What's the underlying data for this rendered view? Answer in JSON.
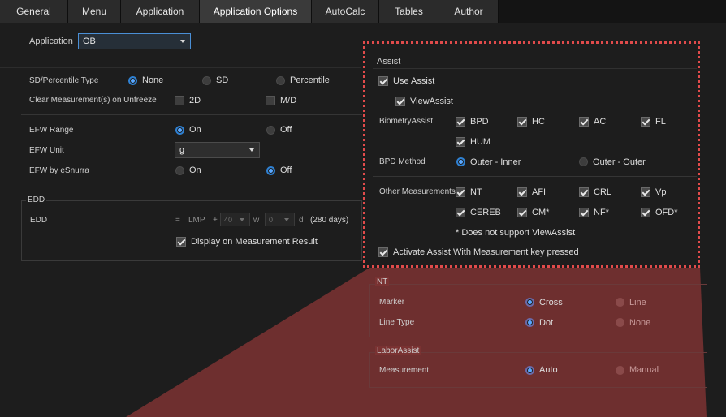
{
  "tabs": [
    "General",
    "Menu",
    "Application",
    "Application Options",
    "AutoCalc",
    "Tables",
    "Author"
  ],
  "active_tab": "Application Options",
  "application": {
    "label": "Application",
    "value": "OB"
  },
  "sd_percentile": {
    "label": "SD/Percentile Type",
    "options": [
      "None",
      "SD",
      "Percentile"
    ],
    "selected": "None"
  },
  "clear_meas": {
    "label": "Clear Measurement(s) on Unfreeze",
    "options": [
      "2D",
      "M/D"
    ],
    "checked": [
      false,
      false
    ]
  },
  "efw_range": {
    "label": "EFW Range",
    "options": [
      "On",
      "Off"
    ],
    "selected": "On"
  },
  "efw_unit": {
    "label": "EFW Unit",
    "value": "g"
  },
  "efw_esnurra": {
    "label": "EFW by eSnurra",
    "options": [
      "On",
      "Off"
    ],
    "selected": "Off"
  },
  "edd": {
    "title": "EDD",
    "label": "EDD",
    "eq": "=",
    "lmp": "LMP",
    "plus": "+",
    "weeks_value": "40",
    "w": "w",
    "days_value": "0",
    "d": "d",
    "total": "(280 days)",
    "display_label": "Display on Measurement Result",
    "display_checked": true
  },
  "assist": {
    "title": "Assist",
    "use_assist": "Use Assist",
    "view_assist": "ViewAssist",
    "biometry_label": "BiometryAssist",
    "biometry_items": [
      "BPD",
      "HC",
      "AC",
      "FL",
      "HUM"
    ],
    "bpd_method_label": "BPD Method",
    "bpd_method_options": [
      "Outer - Inner",
      "Outer - Outer"
    ],
    "bpd_method_selected": "Outer - Inner",
    "other_label": "Other Measurements",
    "other_items": [
      "NT",
      "AFI",
      "CRL",
      "Vp",
      "CEREB",
      "CM*",
      "NF*",
      "OFD*"
    ],
    "note": "* Does not support ViewAssist",
    "activate_label": "Activate Assist With Measurement key pressed"
  },
  "nt": {
    "title": "NT",
    "marker_label": "Marker",
    "marker_options": [
      "Cross",
      "Line"
    ],
    "line_type_label": "Line Type",
    "line_type_options": [
      "Dot",
      "None"
    ]
  },
  "labor": {
    "title": "LaborAssist",
    "measurement_label": "Measurement",
    "options": [
      "Auto",
      "Manual"
    ]
  },
  "colors": {
    "accent": "#2f80d1",
    "highlight": "#e14b4b",
    "wedge": "#8a3535"
  }
}
